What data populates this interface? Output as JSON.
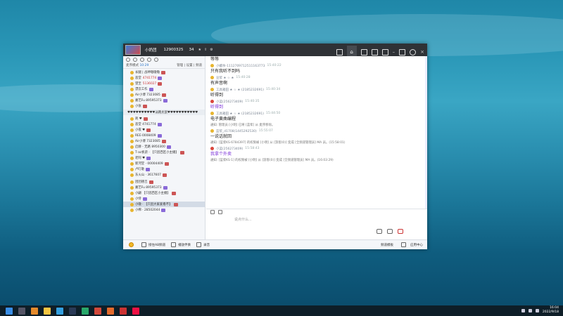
{
  "window": {
    "title": "小奶团",
    "room_id": "12900325",
    "user_count": "34",
    "accent": "#2f3236"
  },
  "left": {
    "status_label": "麦序模式",
    "time": "10:29",
    "links": [
      "管理",
      "|",
      "设置",
      "|",
      "频道"
    ],
    "users_top": [
      {
        "text": "长腿 | 战神嗷嗷嗷",
        "extra": ""
      },
      {
        "text": "恶堂",
        "extra": "4741774"
      },
      {
        "text": "望至",
        "extra": "5136027"
      },
      {
        "text": "漂云工作",
        "extra": ""
      },
      {
        "text": "Air小博 7323085",
        "extra": ""
      },
      {
        "text": "嘉艺Fu 89595373",
        "extra": ""
      },
      {
        "text": "小张",
        "extra": ""
      }
    ],
    "group_header": "♥♥♥♥♥♥♥♥♥♥淡路太鼠♥♥♥♥♥♥♥♥♥♥♥",
    "users_group": [
      {
        "text": "刺 ♥",
        "extra": ""
      },
      {
        "text": "恶堂 4741774",
        "extra": ""
      },
      {
        "text": "小夜 ♥",
        "extra": ""
      },
      {
        "text": "REE·0008409",
        "extra": ""
      },
      {
        "text": "Air小博 7323085",
        "extra": ""
      },
      {
        "text": "启赫 - 无路 8950300",
        "extra": ""
      },
      {
        "text": "T·ac帆弟 · 【只因西区小主播】",
        "extra": ""
      },
      {
        "text": "老阿 ♥",
        "extra": ""
      },
      {
        "text": "新河堂 · 00004409",
        "extra": ""
      },
      {
        "text": "卢叮歌",
        "extra": ""
      },
      {
        "text": "东火山 · 3617607",
        "extra": ""
      }
    ],
    "users_bottom": [
      {
        "text": "团团德吉",
        "extra": ""
      },
      {
        "text": "嘉艺Fu 89595373",
        "extra": ""
      },
      {
        "text": "小翩 【只因西区小主播】",
        "extra": ""
      },
      {
        "text": "小恃",
        "extra": ""
      },
      {
        "text": "小嗷 · 【只因大家爱看不】",
        "extra": ""
      },
      {
        "text": "小棉 · 28502044",
        "extra": ""
      }
    ]
  },
  "messages": [
    {
      "type": "text",
      "name": "",
      "time": "",
      "text": "等等",
      "purple": false
    },
    {
      "type": "text",
      "name": "小螺杀-1112709712511163773",
      "time": "15:40:22",
      "text": "只有我听不到吗",
      "purple": false
    },
    {
      "type": "text",
      "name": "豆浆 ★ ☆ ★",
      "time": "15:40:28",
      "text": "有声音啊",
      "purple": false
    },
    {
      "type": "text",
      "name": "工具箱田 ★ ☆ ★ (2185232691)",
      "time": "15:40:34",
      "text": "听得到",
      "purple": false
    },
    {
      "type": "text",
      "name": "小蓝(256273409)",
      "time": "15:40:35",
      "text": "听得到",
      "purple": true,
      "red": true
    },
    {
      "type": "text",
      "name": "工具箱田 ★ ☆ ★ (2185232691)",
      "time": "15:44:50",
      "text": "电子黄曲编程",
      "purple": false
    },
    {
      "type": "sys",
      "text": "通知: 管理员 [小明] 已将 [蓝浆] 从 麦序移除。"
    },
    {
      "type": "text",
      "name": "蓝浆_d1708(1445292530)",
      "time": "15:55:07",
      "text": "一说话就回",
      "purple": false
    },
    {
      "type": "sys",
      "text": "通知: [蓝浆KS·6784397] 的权限被 [小明] 从 [游客(0)] 变成 [全频道管理员] MA 员。(15:58:01)"
    },
    {
      "type": "text",
      "name": "小蓝(256273409)",
      "time": "15:58:43",
      "text": "我拿个外卖",
      "purple": true,
      "red": true
    },
    {
      "type": "sys",
      "text": "通知: [蓝浆KS·1] 的权限被 [小明] 从 [游客(0)] 变成 [全频道管理员] MA 员。(16:03:29)"
    }
  ],
  "input": {
    "placeholder": "说点什么..."
  },
  "footer": {
    "items": [
      "接住AB频道",
      "播放伴奏",
      "录音"
    ],
    "right": [
      "频道模板",
      "应用中心"
    ]
  },
  "taskbar": {
    "time": "16:04",
    "date": "2022/9/18"
  }
}
